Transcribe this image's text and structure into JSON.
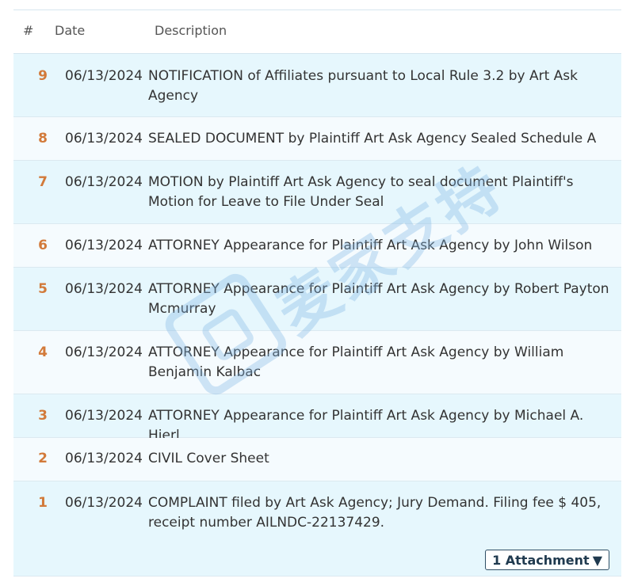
{
  "headers": {
    "num": "#",
    "date": "Date",
    "description": "Description"
  },
  "rows": [
    {
      "num": "9",
      "date": "06/13/2024",
      "desc": "NOTIFICATION of Affiliates pursuant to Local Rule 3.2 by Art Ask Agency"
    },
    {
      "num": "8",
      "date": "06/13/2024",
      "desc": "SEALED DOCUMENT by Plaintiff Art Ask Agency Sealed Schedule A"
    },
    {
      "num": "7",
      "date": "06/13/2024",
      "desc": "MOTION by Plaintiff Art Ask Agency to seal document Plaintiff's Motion for Leave to File Under Seal"
    },
    {
      "num": "6",
      "date": "06/13/2024",
      "desc": "ATTORNEY Appearance for Plaintiff Art Ask Agency by John Wilson"
    },
    {
      "num": "5",
      "date": "06/13/2024",
      "desc": "ATTORNEY Appearance for Plaintiff Art Ask Agency by Robert Payton Mcmurray"
    },
    {
      "num": "4",
      "date": "06/13/2024",
      "desc": "ATTORNEY Appearance for Plaintiff Art Ask Agency by William Benjamin Kalbac"
    },
    {
      "num": "3",
      "date": "06/13/2024",
      "desc": "ATTORNEY Appearance for Plaintiff Art Ask Agency by Michael A. Hierl"
    },
    {
      "num": "2",
      "date": "06/13/2024",
      "desc": "CIVIL Cover Sheet"
    },
    {
      "num": "1",
      "date": "06/13/2024",
      "desc": "COMPLAINT filed by Art Ask Agency; Jury Demand. Filing fee $ 405, receipt number AILNDC-22137429."
    }
  ],
  "attachment": {
    "label": "1 Attachment",
    "icon": "caret-down-icon",
    "caret": "▼"
  },
  "watermark": {
    "text": "麦家支持"
  },
  "colors": {
    "row_a": "#e6f7fd",
    "row_b": "#f5fbfe",
    "number": "#d27a3a"
  }
}
